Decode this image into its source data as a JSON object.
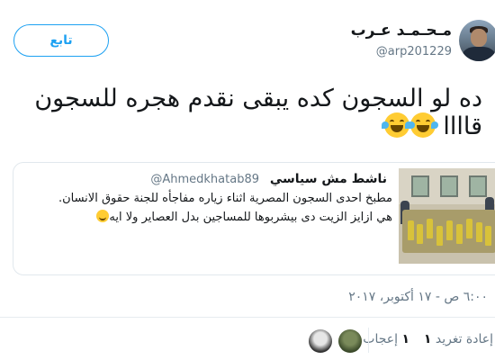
{
  "tweet": {
    "author": {
      "display_name": "مـحـمـد عـرب",
      "handle": "@arp201229",
      "avatar_icon": "user-avatar-icon"
    },
    "follow_label": "تابع",
    "text_lines": [
      "ده لو السجون كده يبقى نقدم هجره للسجون",
      "قاااا"
    ],
    "emoji_name": "face-with-tears-of-joy-icon",
    "timestamp": "٦:٠٠ ص - ١٧ أكتوبر، ٢٠١٧"
  },
  "quoted_tweet": {
    "author_name": "ناشط مش سياسي",
    "author_handle": "@Ahmedkhatab89",
    "text_lines": [
      "مطبخ احدى السجون المصرية اثناء زياره مفاجأه للجنة حقوق الانسان.",
      "هي ازايز الزيت دى بيشربوها للمساجين بدل العصاير ولا ايه"
    ],
    "image_icon": "prison-kitchen-photo"
  },
  "stats": {
    "retweet_count": "١",
    "retweet_label": "إعادة تغريد",
    "like_count": "١",
    "like_label": "إعجاب"
  },
  "colors": {
    "accent": "#1da1f2",
    "text": "#14171a",
    "muted": "#657786",
    "border": "#e1e8ed",
    "emoji": "#ffcc33"
  }
}
